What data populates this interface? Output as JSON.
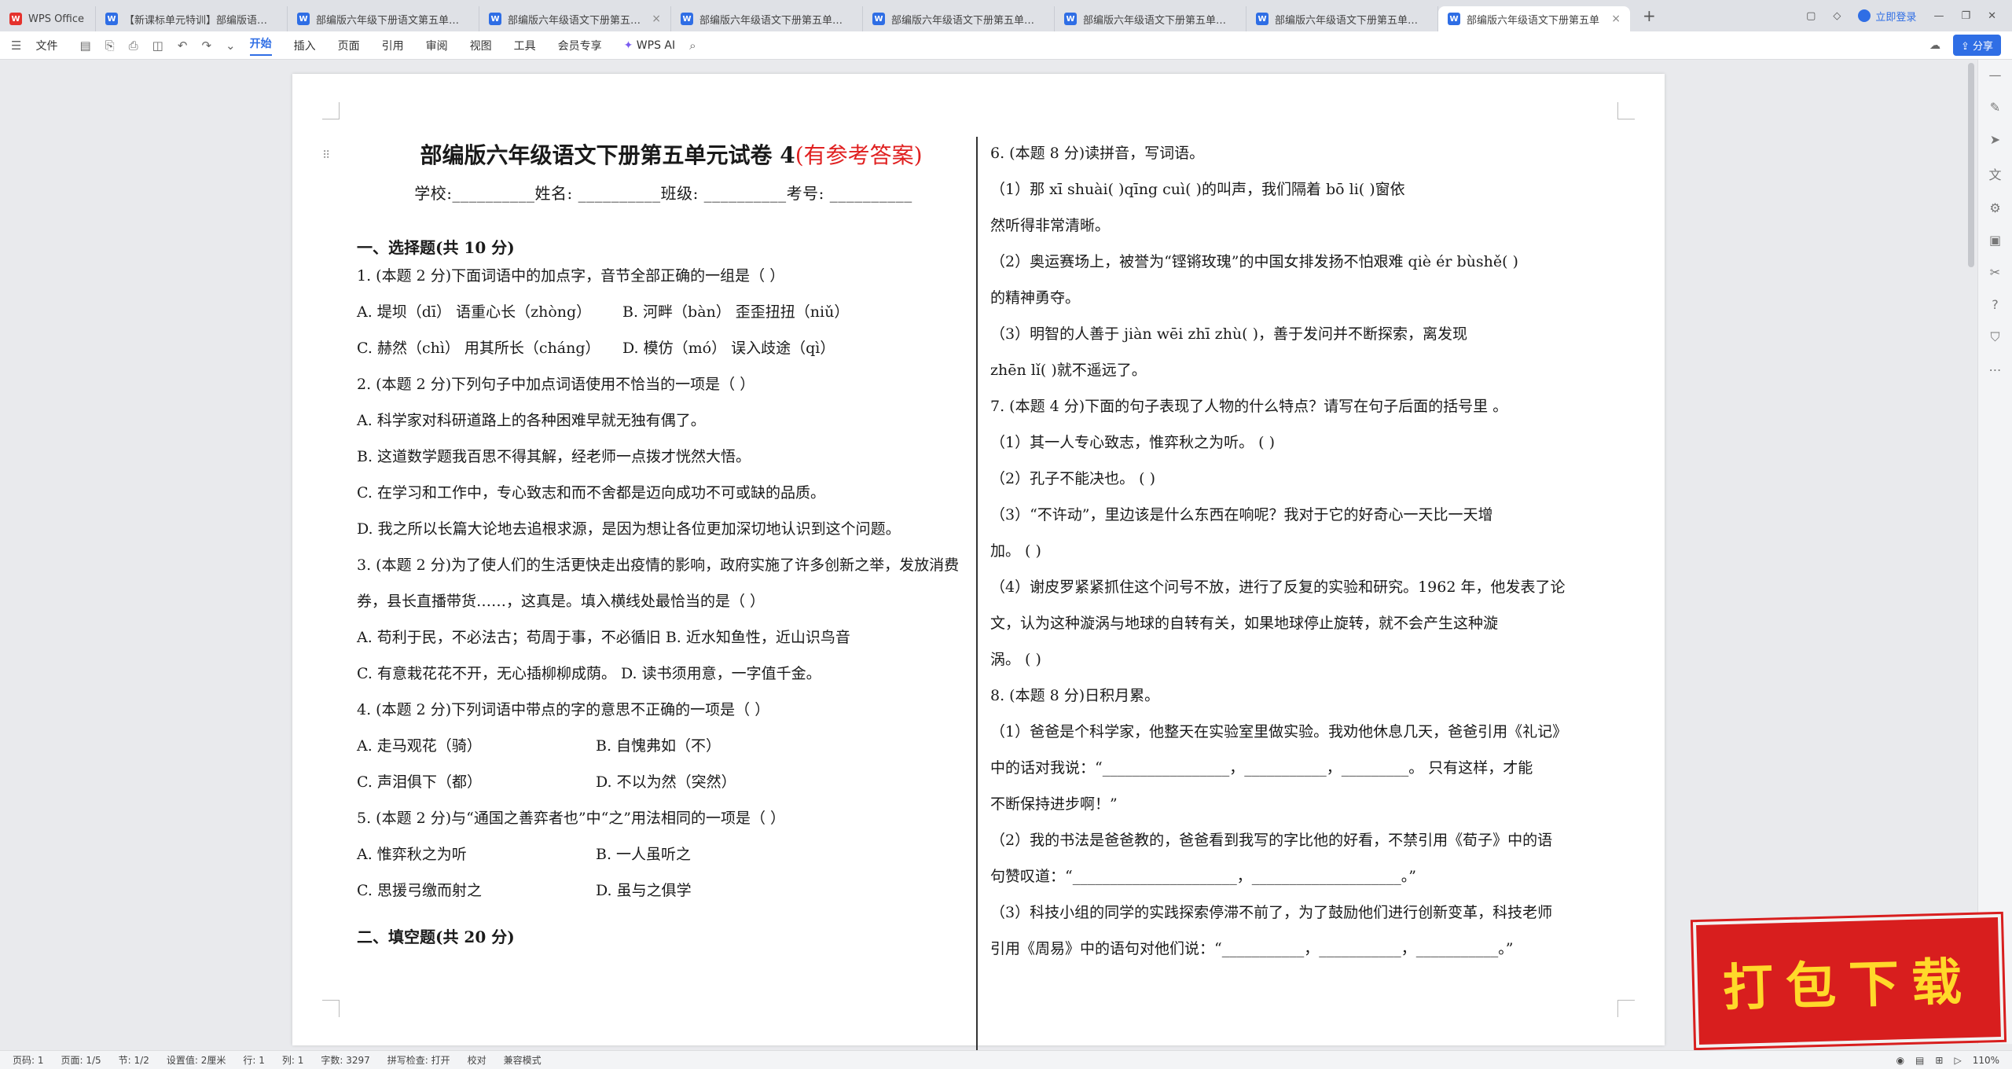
{
  "tabs": [
    {
      "label": "WPS Office",
      "kind": "wps"
    },
    {
      "label": "【新课标单元特训】部编版语文六年级",
      "kind": "doc"
    },
    {
      "label": "部编版六年级下册语文第五单元测试卷",
      "kind": "doc"
    },
    {
      "label": "部编版六年级语文下册第五单元测试卷",
      "kind": "doc"
    },
    {
      "label": "部编版六年级语文下册第五单元测试卷",
      "kind": "doc"
    },
    {
      "label": "部编版六年级语文下册第五单元试卷",
      "kind": "doc"
    },
    {
      "label": "部编版六年级语文下册第五单元试卷",
      "kind": "doc"
    },
    {
      "label": "部编版六年级语文下册第五单元试卷",
      "kind": "doc"
    },
    {
      "label": "部编版六年级语文下册第五单",
      "kind": "doc",
      "active": true
    }
  ],
  "titlebar": {
    "login": "立即登录"
  },
  "ribbon": {
    "file": "文件",
    "tabs": [
      "开始",
      "插入",
      "页面",
      "引用",
      "审阅",
      "视图",
      "工具",
      "会员专享"
    ],
    "active_tab": "开始",
    "wps_ai": "WPS AI",
    "share": "分享"
  },
  "doc": {
    "title": "部编版六年级语文下册第五单元试卷 4",
    "title_suffix": "(有参考答案)",
    "fields": "学校:__________姓名: __________班级: __________考号: __________",
    "sec1": "一、选择题(共 10 分)",
    "q1": "1. (本题 2 分)下面词语中的加点字，音节全部正确的一组是（    ）",
    "q1_a1": "A.  堤坝（dī）    语重心长（zhòng）",
    "q1_b1": "B.  河畔（bàn）     歪歪扭扭（niǔ）",
    "q1_c1": "C.  赫然（chì）    用其所长（cháng）",
    "q1_d1": "D.  模仿（mó）     误入歧途（qì）",
    "q2": "2. (本题 2 分)下列句子中加点词语使用不恰当的一项是（      ）",
    "q2_a": "A.  科学家对科研道路上的各种困难早就无独有偶了。",
    "q2_b": "B.  这道数学题我百思不得其解，经老师一点拨才恍然大悟。",
    "q2_c": "C.  在学习和工作中，专心致志和而不舍都是迈向成功不可或缺的品质。",
    "q2_d": "D.  我之所以长篇大论地去追根求源，是因为想让各位更加深切地认识到这个问题。",
    "q3": "3. (本题 2 分)为了使人们的生活更快走出疫情的影响，政府实施了许多创新之举，发放消费券，县长直播带货……，这真是。填入横线处最恰当的是（    ）",
    "q3_ab": "A.  苟利于民，不必法古；苟周于事，不必循旧  B.  近水知鱼性，近山识鸟音",
    "q3_cd": "C.  有意栽花花不开，无心插柳柳成荫。  D.  读书须用意，一字值千金。",
    "q4": "4. (本题 2 分)下列词语中带点的字的意思不正确的一项是（      ）",
    "q4_a": "A.  走马观花（骑）",
    "q4_b": "B.  自愧弗如（不）",
    "q4_c": "C.  声泪俱下（都）",
    "q4_d": "D.  不以为然（突然）",
    "q5": "5. (本题 2 分)与“通国之善弈者也”中“之”用法相同的一项是（    ）",
    "q5_a": "A.  惟弈秋之为听",
    "q5_b": "B.  一人虽听之",
    "q5_c": "C.  思援弓缴而射之",
    "q5_d": "D.  虽与之俱学",
    "sec2": "二、填空题(共 20 分)",
    "q6": "6. (本题 8 分)读拼音，写词语。",
    "q6_1a": "（1）那 xī shuài(              )qīng cuì(              )的叫声，我们隔着 bō li(              )窗依",
    "q6_1b": "然听得非常清晰。",
    "q6_2a": "（2）奥运赛场上，被誉为“铿锵玫瑰”的中国女排发扬不怕艰难 qiè ér bùshě(                 )",
    "q6_2b": "的精神勇夺。",
    "q6_3a": "（3）明智的人善于 jiàn wēi zhī zhù(               )，善于发问并不断探索，离发现",
    "q6_3b": "zhēn lǐ(               )就不遥远了。",
    "q7": "7. (本题 4 分)下面的句子表现了人物的什么特点？请写在句子后面的括号里 。",
    "q7_1": "（1）其一人专心致志，惟弈秋之为听。                         (                      )",
    "q7_2": "（2）孔子不能决也。                                       (                      )",
    "q7_3a": "（3）“不许动”，里边该是什么东西在响呢？我对于它的好奇心一天比一天增",
    "q7_3b": "加。                                                     (                      )",
    "q7_4a": "（4）谢皮罗紧紧抓住这个问号不放，进行了反复的实验和研究。1962 年，他发表了论",
    "q7_4b": "文，认为这种漩涡与地球的自转有关，如果地球停止旋转，就不会产生这种漩",
    "q7_4c": "涡。                                                 (                      )",
    "q8": "8. (本题 8 分)日积月累。",
    "q8_1a": "（1）爸爸是个科学家，他整天在实验室里做实验。我劝他休息几天，爸爸引用《礼记》",
    "q8_1b": "中的话对我说：“_________________，___________，_________。  只有这样，才能",
    "q8_1c": "不断保持进步啊！”",
    "q8_2a": "（2）我的书法是爸爸教的，爸爸看到我写的字比他的好看，不禁引用《荀子》中的语",
    "q8_2b": "句赞叹道：“______________________，____________________。”",
    "q8_3a": "（3）科技小组的同学的实践探索停滞不前了，为了鼓励他们进行创新变革，科技老师",
    "q8_3b": "引用《周易》中的语句对他们说：“___________，___________，___________。”"
  },
  "status": {
    "page_code": "页码: 1",
    "pages": "页面: 1/5",
    "section": "节: 1/2",
    "setting": "设置值: 2厘米",
    "row": "行: 1",
    "col": "列: 1",
    "words": "字数: 3297",
    "spell": "拼写检查: 打开",
    "proof": "校对",
    "compat": "兼容模式",
    "zoom": "110%"
  },
  "banner": {
    "text": "打包下载"
  },
  "colors": {
    "accent": "#2f6ee5",
    "answer_red": "#e02020",
    "banner_red": "#d81e1e",
    "banner_text": "#ffd92a"
  }
}
